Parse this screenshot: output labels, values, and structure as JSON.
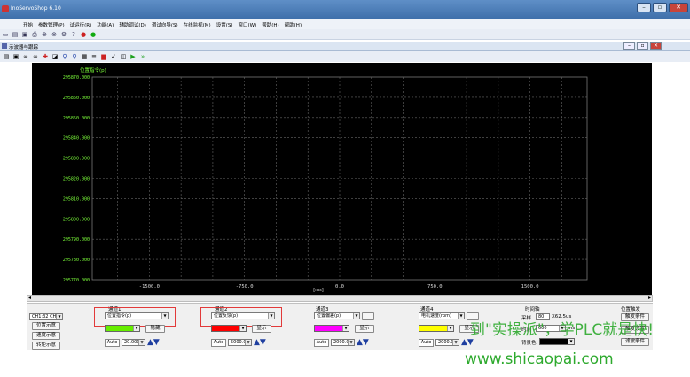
{
  "window": {
    "title": "InoServoShop 6.10",
    "btn_min": "–",
    "btn_max": "▫",
    "btn_close": "✕"
  },
  "menu": [
    "开始",
    "参数管理(P)",
    "试运行(R)",
    "功能(A)",
    "辅助调试(D)",
    "调试向导(S)",
    "在线监视(M)",
    "设置(S)",
    "窗口(W)",
    "帮助(H)",
    "帮助(H)"
  ],
  "child_window": {
    "title": "示波器与跟踪",
    "btn_min": "–",
    "btn_max": "▫",
    "btn_close": "✕"
  },
  "toolbar_icons": [
    "new-icon",
    "open-icon",
    "save-icon",
    "print-icon",
    "connect-icon",
    "disconnect-icon",
    "settings-icon",
    "help-icon",
    "stop-icon",
    "run-icon"
  ],
  "chart_data": {
    "type": "line",
    "title": "",
    "series_label": "位置指令(p)",
    "xlabel": "[ms]",
    "ylabel": "位置指令(p)",
    "xlim": [
      -1950,
      1950
    ],
    "ylim": [
      295770,
      295870
    ],
    "x_ticks": [
      -1500.0,
      -750.0,
      0.0,
      750.0,
      1500.0
    ],
    "x_tick_labels": [
      "-1500.0",
      "-750.0",
      "0.0",
      "750.0",
      "1500.0"
    ],
    "y_tick_labels": [
      "295870.000",
      "295860.000",
      "295850.000",
      "295840.000",
      "295830.000",
      "295820.000",
      "295810.000",
      "295800.000",
      "295790.000",
      "295780.000",
      "295770.000"
    ],
    "grid": true,
    "series": []
  },
  "panel": {
    "left_select": "CH1:32 CH2",
    "left_buttons": [
      "位置示意",
      "速度示意",
      "转矩示意"
    ],
    "channels": [
      {
        "label": "通道1",
        "signal": "位置指令(p)",
        "color": "#66ee00",
        "btn": "隐藏",
        "auto": "Auto",
        "scale": "20.000"
      },
      {
        "label": "通道2",
        "signal": "位置反馈(p)",
        "color": "#ff0000",
        "btn": "显示",
        "auto": "Auto",
        "scale": "5000.0"
      },
      {
        "label": "通道3",
        "signal": "位置偏差(p)",
        "color": "#ff00ff",
        "btn": "显示",
        "auto": "Auto",
        "scale": "2000.0"
      },
      {
        "label": "通道4",
        "signal": "电机速度(rpm)",
        "color": "#ffff00",
        "btn": "显示",
        "auto": "Auto",
        "scale": "2000.0"
      }
    ],
    "time_axis": {
      "label": "时间轴",
      "sample_label": "采样",
      "sample_value": "80",
      "sample_unit": "X62.5us",
      "range_label": "时间",
      "range_value": "600",
      "range_unit": "ms",
      "bg_label": "背景色"
    },
    "trigger": {
      "label": "位置触发",
      "buttons": [
        "触发条件",
        "触发设置",
        "滤波条件"
      ]
    }
  },
  "watermark": {
    "line1": "到\"实操派\"，学PLC就是快!",
    "line2": "www.shicaopai.com"
  }
}
